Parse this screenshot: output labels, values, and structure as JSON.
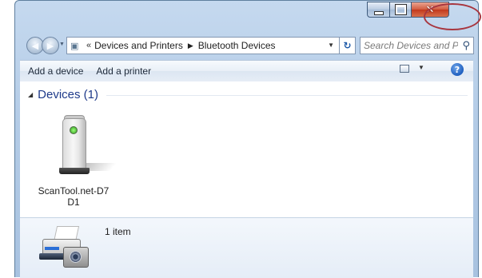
{
  "window": {
    "caption": {
      "minimize": "minimize",
      "maximize": "maximize",
      "close": "✕"
    }
  },
  "address_bar": {
    "overflow_chevron": "«",
    "breadcrumbs": [
      "Devices and Printers",
      "Bluetooth Devices"
    ],
    "separator": "▶"
  },
  "search": {
    "placeholder": "Search Devices and Pri..."
  },
  "toolbar": {
    "add_device": "Add a device",
    "add_printer": "Add a printer"
  },
  "group": {
    "title": "Devices (1)"
  },
  "devices": [
    {
      "label": "ScanTool.net-D7D1",
      "icon": "bluetooth-device-tower-icon"
    }
  ],
  "details": {
    "count": "1 item",
    "icon": "devices-and-printers-icon"
  },
  "colors": {
    "frame": "#b3cbe6",
    "close_button": "#c2391c",
    "group_title": "#1e3a8a",
    "annotation_circle": "#a8363f"
  }
}
